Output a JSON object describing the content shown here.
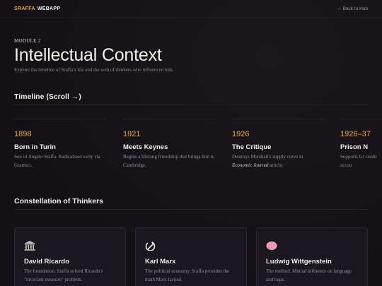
{
  "header": {
    "brand_accent": "SRAFFA",
    "brand_rest": "WEBAPP",
    "back_link": "← Back to Hub"
  },
  "intro": {
    "module": "MODULE 2",
    "title": "Intellectual Context",
    "subtitle": "Explore the timeline of Sraffa's life and the web of thinkers who influenced him."
  },
  "timeline": {
    "heading": "Timeline (Scroll →)",
    "items": [
      {
        "year": "1898",
        "title": "Born in Turin",
        "desc": "Son of Angelo Sraffa. Radicalized early via Gramsci."
      },
      {
        "year": "1921",
        "title": "Meets Keynes",
        "desc": "Begins a lifelong friendship that brings him to Cambridge."
      },
      {
        "year": "1926",
        "title": "The Critique",
        "desc_before": "Destroys Marshall's supply curve in ",
        "desc_em": "Economic Journal",
        "desc_after": " article."
      },
      {
        "year": "1926–37",
        "title": "Prison N",
        "desc": "Supports Gr credit accou"
      }
    ]
  },
  "thinkers": {
    "heading": "Constellation of Thinkers",
    "cards": [
      {
        "icon": "classical-building-icon",
        "name": "David Ricardo",
        "desc": "The foundation. Sraffa solved Ricardo's \"invariant measure\" problem."
      },
      {
        "icon": "hammer-sickle-icon",
        "name": "Karl Marx",
        "desc": "The political economy. Sraffa provides the math Marx lacked."
      },
      {
        "icon": "brain-icon",
        "name": "Ludwig Wittgenstein",
        "desc": "The method. Mutual influence on language and logic."
      }
    ]
  },
  "colors": {
    "accent": "#e7a93c",
    "background": "#141217",
    "card": "#1a181e"
  }
}
